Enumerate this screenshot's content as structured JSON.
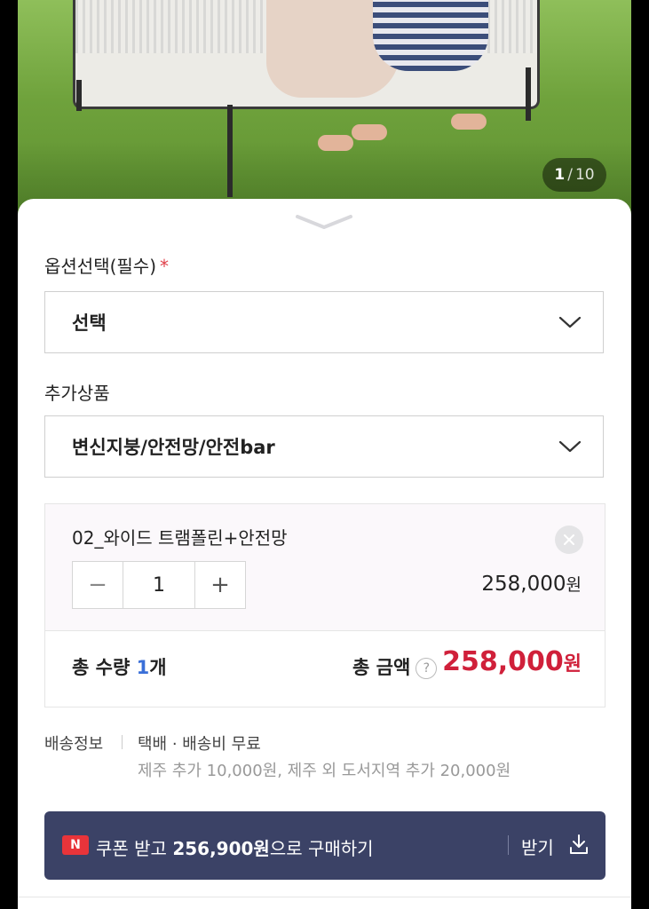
{
  "photo": {
    "counter_current": "1",
    "counter_separator": "/",
    "counter_total": "10"
  },
  "option": {
    "label": "옵션선택(필수)",
    "required_mark": "*",
    "select_value": "선택"
  },
  "addon": {
    "label": "추가상품",
    "select_value": "변신지붕/안전망/안전bar"
  },
  "selected_item": {
    "name": "02_와이드 트램폴린+안전망",
    "quantity": "1",
    "minus": "−",
    "plus": "+",
    "price": "258,000",
    "price_unit": "원"
  },
  "totals": {
    "qty_prefix": "총 수량 ",
    "qty_value": "1",
    "qty_suffix": "개",
    "amount_label": "총 금액",
    "help": "?",
    "amount": "258,000",
    "amount_unit": "원"
  },
  "shipping": {
    "label": "배송정보",
    "value": "택배 · 배송비 무료",
    "note": "제주 추가 10,000원, 제주 외 도서지역 추가 20,000원"
  },
  "coupon": {
    "badge": "N",
    "prefix": "쿠폰 받고 ",
    "amount": "256,900원",
    "suffix": "으로 구매하기",
    "action": "받기"
  },
  "colors": {
    "accent_red": "#d0203a",
    "qty_blue": "#3a6fd8",
    "coupon_bg": "#3b4266",
    "required_red": "#e0404a"
  }
}
